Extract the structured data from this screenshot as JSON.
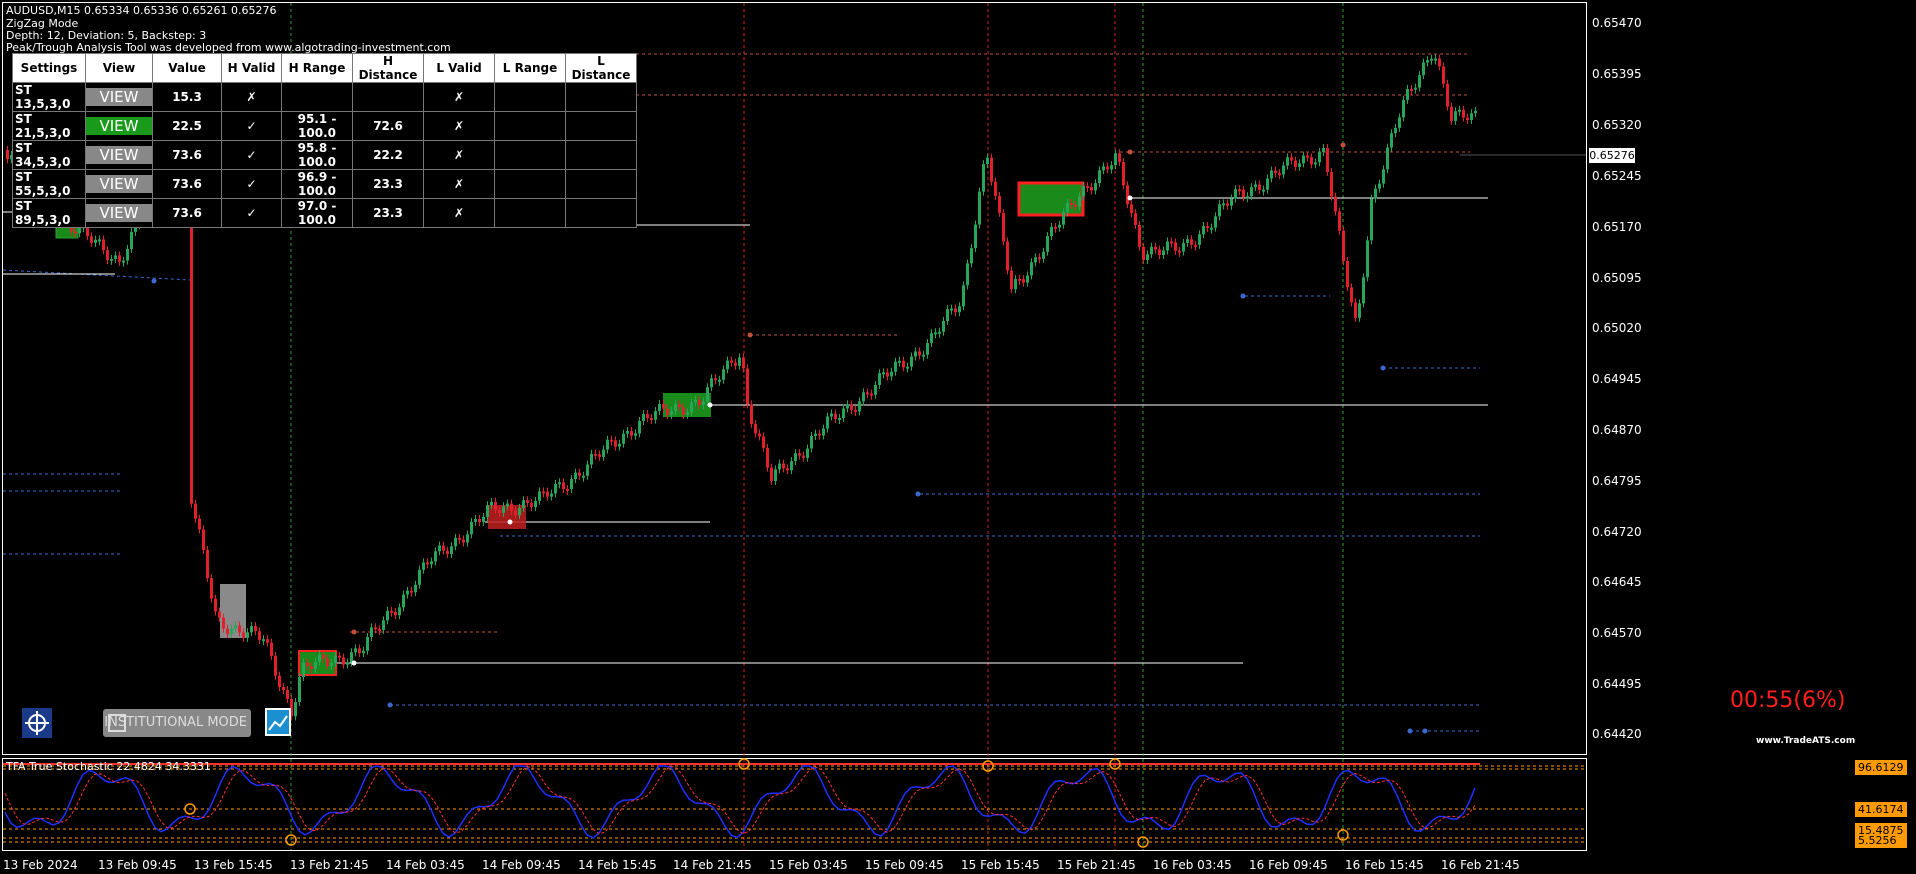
{
  "header": {
    "symbol_line": "AUDUSD,M15  0.65334 0.65336 0.65261 0.65276",
    "mode_line": "ZigZag Mode",
    "params_line": "Depth: 12, Deviation: 5, Backstep: 3",
    "tool_line": "Peak/Trough Analysis Tool was developed from www.algotrading-investment.com"
  },
  "table": {
    "headers": [
      "Settings",
      "View",
      "Value",
      "H Valid",
      "H Range",
      "H Distance",
      "L Valid",
      "L Range",
      "L Distance"
    ],
    "rows": [
      {
        "settings": "ST 13,5,3,0",
        "view": "VIEW",
        "value": "15.3",
        "h_valid": "✗",
        "h_range": "",
        "h_distance": "",
        "l_valid": "✗",
        "l_range": "",
        "l_distance": ""
      },
      {
        "settings": "ST 21,5,3,0",
        "view": "VIEW",
        "value": "22.5",
        "h_valid": "✓",
        "h_range": "95.1 - 100.0",
        "h_distance": "72.6",
        "l_valid": "✗",
        "l_range": "",
        "l_distance": ""
      },
      {
        "settings": "ST 34,5,3,0",
        "view": "VIEW",
        "value": "73.6",
        "h_valid": "✓",
        "h_range": "95.8 - 100.0",
        "h_distance": "22.2",
        "l_valid": "✗",
        "l_range": "",
        "l_distance": ""
      },
      {
        "settings": "ST 55,5,3,0",
        "view": "VIEW",
        "value": "73.6",
        "h_valid": "✓",
        "h_range": "96.9 - 100.0",
        "h_distance": "23.3",
        "l_valid": "✗",
        "l_range": "",
        "l_distance": ""
      },
      {
        "settings": "ST 89,5,3,0",
        "view": "VIEW",
        "value": "73.6",
        "h_valid": "✓",
        "h_range": "97.0 - 100.0",
        "h_distance": "23.3",
        "l_valid": "✗",
        "l_range": "",
        "l_distance": ""
      }
    ]
  },
  "price_axis": [
    "0.65470",
    "0.65395",
    "0.65320",
    "0.65245",
    "0.65170",
    "0.65095",
    "0.65020",
    "0.64945",
    "0.64870",
    "0.64795",
    "0.64720",
    "0.64645",
    "0.64570",
    "0.64495",
    "0.64420"
  ],
  "current_price": "0.65276",
  "time_axis": [
    "13 Feb 2024",
    "13 Feb 09:45",
    "13 Feb 15:45",
    "13 Feb 21:45",
    "14 Feb 03:45",
    "14 Feb 09:45",
    "14 Feb 15:45",
    "14 Feb 21:45",
    "15 Feb 03:45",
    "15 Feb 09:45",
    "15 Feb 15:45",
    "15 Feb 21:45",
    "16 Feb 03:45",
    "16 Feb 09:45",
    "16 Feb 15:45",
    "16 Feb 21:45"
  ],
  "timer": "00:55(6%)",
  "brand": "www.TradeATS.com",
  "institutional_label": "INSTITUTIONAL MODE",
  "subwindow": {
    "label": "TFA True Stochastic 22.4824 34.3331",
    "levels": [
      "96.6129",
      "41.6174",
      "15.4875",
      "5.5256"
    ]
  },
  "colors": {
    "bull": "#26a65b",
    "bear": "#e0202a",
    "fast": "#1f2fff",
    "slow": "#ff3030",
    "level": "#ff9a00"
  }
}
